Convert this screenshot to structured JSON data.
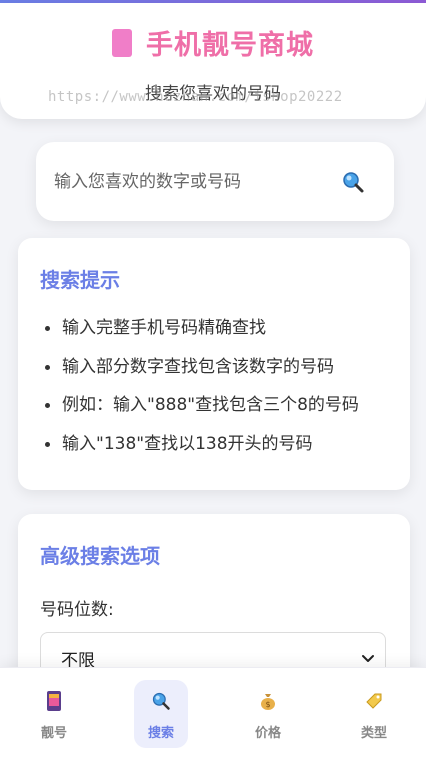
{
  "header": {
    "title": "手机靓号商城",
    "subtitle": "搜索您喜欢的号码",
    "watermark": "https://www.huzhan.com/ishop20222"
  },
  "search": {
    "placeholder": "输入您喜欢的数字或号码",
    "icon": "search-icon"
  },
  "tips": {
    "title": "搜索提示",
    "items": [
      "输入完整手机号码精确查找",
      "输入部分数字查找包含该数字的号码",
      "例如：输入\"888\"查找包含三个8的号码",
      "输入\"138\"查找以138开头的号码"
    ]
  },
  "advanced": {
    "title": "高级搜索选项",
    "digits_label": "号码位数:",
    "digits_selected": "不限"
  },
  "tabbar": {
    "items": [
      {
        "label": "靓号",
        "icon": "phone-icon",
        "active": false
      },
      {
        "label": "搜索",
        "icon": "search-icon",
        "active": true
      },
      {
        "label": "价格",
        "icon": "money-bag-icon",
        "active": false
      },
      {
        "label": "类型",
        "icon": "tag-icon",
        "active": false
      }
    ]
  },
  "colors": {
    "accent": "#6b7fe6",
    "brand": "#ef6fa8",
    "phone_icon": "#f07ec8"
  }
}
